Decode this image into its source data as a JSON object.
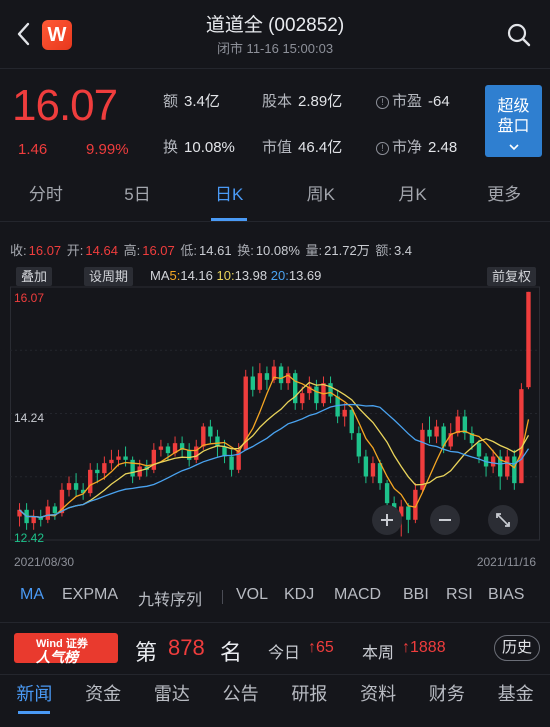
{
  "header": {
    "title": "道道全 (002852)",
    "subtitle": "闭市 11-16 15:00:03",
    "logo_text": "W",
    "icons": {
      "back": "chevron-left-icon",
      "search": "search-icon"
    }
  },
  "quote": {
    "price": "16.07",
    "change": "1.46",
    "change_pct": "9.99%",
    "stats": [
      {
        "label": "额",
        "value": "3.4亿"
      },
      {
        "label": "股本",
        "value": "2.89亿"
      },
      {
        "label": "市盈",
        "value": "-64"
      },
      {
        "label": "换",
        "value": "10.08%"
      },
      {
        "label": "市值",
        "value": "46.4亿"
      },
      {
        "label": "市净",
        "value": "2.48"
      }
    ],
    "level2_button": [
      "超级",
      "盘口"
    ],
    "colors": {
      "up": "#ef3d3d",
      "down": "#1ec28b",
      "accent": "#4a9af5"
    }
  },
  "tabs": [
    {
      "label": "分时",
      "active": false
    },
    {
      "label": "5日",
      "active": false
    },
    {
      "label": "日K",
      "active": true
    },
    {
      "label": "周K",
      "active": false
    },
    {
      "label": "月K",
      "active": false
    },
    {
      "label": "更多",
      "active": false
    }
  ],
  "ohlc": {
    "close_label": "收:",
    "close": "16.07",
    "open_label": "开:",
    "open": "14.64",
    "high_label": "高:",
    "high": "16.07",
    "low_label": "低:",
    "low": "14.61",
    "turnover_label": "换:",
    "turnover": "10.08%",
    "volume_label": "量:",
    "volume": "21.72万",
    "amount_label": "额:",
    "amount": "3.4"
  },
  "chart_controls": {
    "overlay": "叠加",
    "set_period": "设周期",
    "adjust": "前复权",
    "ma5_label": "MA",
    "ma5_num": "5:",
    "ma5": "14.16",
    "ma10_num": "10:",
    "ma10": "13.98",
    "ma20_num": "20:",
    "ma20": "13.69"
  },
  "chart_data": {
    "type": "candlestick",
    "y_labels": [
      "16.07",
      "14.24",
      "12.42"
    ],
    "ylim": [
      12.42,
      16.07
    ],
    "x_start": "2021/08/30",
    "x_end": "2021/11/16",
    "candles": [
      [
        12.7,
        12.8,
        12.55,
        12.9
      ],
      [
        12.8,
        12.6,
        12.5,
        12.9
      ],
      [
        12.6,
        12.7,
        12.5,
        12.8
      ],
      [
        12.7,
        12.65,
        12.55,
        12.8
      ],
      [
        12.65,
        12.85,
        12.6,
        12.95
      ],
      [
        12.85,
        12.75,
        12.65,
        12.9
      ],
      [
        12.75,
        13.1,
        12.7,
        13.2
      ],
      [
        13.1,
        13.2,
        13.0,
        13.3
      ],
      [
        13.2,
        13.1,
        13.0,
        13.35
      ],
      [
        13.1,
        13.05,
        12.95,
        13.2
      ],
      [
        13.05,
        13.4,
        13.0,
        13.5
      ],
      [
        13.4,
        13.35,
        13.2,
        13.5
      ],
      [
        13.35,
        13.5,
        13.25,
        13.6
      ],
      [
        13.5,
        13.55,
        13.4,
        13.7
      ],
      [
        13.55,
        13.6,
        13.45,
        13.7
      ],
      [
        13.6,
        13.55,
        13.45,
        13.75
      ],
      [
        13.55,
        13.3,
        13.2,
        13.6
      ],
      [
        13.3,
        13.45,
        13.25,
        13.55
      ],
      [
        13.45,
        13.4,
        13.3,
        13.55
      ],
      [
        13.4,
        13.7,
        13.35,
        13.8
      ],
      [
        13.7,
        13.75,
        13.6,
        13.85
      ],
      [
        13.75,
        13.65,
        13.55,
        13.8
      ],
      [
        13.65,
        13.8,
        13.6,
        13.9
      ],
      [
        13.8,
        13.7,
        13.6,
        13.9
      ],
      [
        13.7,
        13.55,
        13.45,
        13.8
      ],
      [
        13.55,
        13.75,
        13.5,
        13.85
      ],
      [
        13.75,
        14.05,
        13.7,
        14.1
      ],
      [
        14.05,
        13.9,
        13.8,
        14.15
      ],
      [
        13.9,
        13.75,
        13.6,
        14.0
      ],
      [
        13.75,
        13.6,
        13.5,
        13.85
      ],
      [
        13.6,
        13.4,
        13.3,
        13.7
      ],
      [
        13.4,
        13.7,
        13.35,
        13.8
      ],
      [
        13.7,
        14.8,
        13.7,
        14.9
      ],
      [
        14.8,
        14.6,
        14.5,
        14.95
      ],
      [
        14.6,
        14.85,
        14.55,
        15.0
      ],
      [
        14.85,
        14.75,
        14.6,
        14.95
      ],
      [
        14.75,
        14.95,
        14.7,
        15.05
      ],
      [
        14.95,
        14.7,
        14.6,
        15.0
      ],
      [
        14.7,
        14.85,
        14.6,
        14.95
      ],
      [
        14.85,
        14.4,
        14.3,
        14.9
      ],
      [
        14.4,
        14.55,
        14.3,
        14.65
      ],
      [
        14.55,
        14.65,
        14.45,
        14.8
      ],
      [
        14.65,
        14.4,
        14.3,
        14.75
      ],
      [
        14.4,
        14.7,
        14.35,
        14.8
      ],
      [
        14.7,
        14.5,
        14.4,
        14.8
      ],
      [
        14.5,
        14.2,
        14.1,
        14.6
      ],
      [
        14.2,
        14.3,
        14.05,
        14.4
      ],
      [
        14.3,
        13.95,
        13.85,
        14.35
      ],
      [
        13.95,
        13.6,
        13.5,
        14.05
      ],
      [
        13.6,
        13.3,
        13.2,
        13.7
      ],
      [
        13.3,
        13.5,
        13.2,
        13.6
      ],
      [
        13.5,
        13.2,
        13.1,
        13.55
      ],
      [
        13.2,
        12.9,
        12.8,
        13.25
      ],
      [
        12.9,
        12.7,
        12.55,
        13.0
      ],
      [
        12.7,
        12.85,
        12.4,
        12.95
      ],
      [
        12.85,
        12.65,
        12.45,
        12.9
      ],
      [
        12.65,
        13.1,
        12.6,
        13.2
      ],
      [
        13.1,
        14.0,
        13.05,
        14.1
      ],
      [
        14.0,
        13.9,
        13.8,
        14.2
      ],
      [
        13.9,
        14.05,
        13.8,
        14.15
      ],
      [
        14.05,
        13.75,
        13.65,
        14.1
      ],
      [
        13.75,
        13.95,
        13.7,
        14.1
      ],
      [
        13.95,
        14.2,
        13.9,
        14.3
      ],
      [
        14.2,
        13.95,
        13.85,
        14.3
      ],
      [
        13.95,
        13.8,
        13.7,
        14.05
      ],
      [
        13.8,
        13.6,
        13.5,
        13.85
      ],
      [
        13.6,
        13.45,
        13.3,
        13.65
      ],
      [
        13.45,
        13.6,
        13.35,
        13.7
      ],
      [
        13.6,
        13.3,
        13.1,
        13.7
      ],
      [
        13.3,
        13.6,
        13.25,
        13.7
      ],
      [
        13.6,
        13.2,
        13.1,
        13.7
      ],
      [
        13.2,
        14.61,
        13.2,
        14.7
      ],
      [
        14.64,
        16.07,
        14.61,
        16.07
      ]
    ],
    "candle_format": [
      "open",
      "close",
      "low",
      "high"
    ]
  },
  "chart_zoom": {
    "zoom_in": "zoom-in-icon",
    "zoom_out": "zoom-out-icon",
    "fullscreen": "expand-icon"
  },
  "indicators": [
    {
      "label": "MA",
      "active": true
    },
    {
      "label": "EXPMA",
      "active": false
    },
    {
      "label": "九转序列",
      "active": false
    },
    {
      "label": "VOL",
      "active": false
    },
    {
      "label": "KDJ",
      "active": false
    },
    {
      "label": "MACD",
      "active": false
    },
    {
      "label": "BBI",
      "active": false
    },
    {
      "label": "RSI",
      "active": false
    },
    {
      "label": "BIAS",
      "active": false
    }
  ],
  "rank": {
    "logo_top": "Wind 证券",
    "logo_main": "人气榜",
    "prefix": "第",
    "rank": "878",
    "suffix": "名",
    "today_label": "今日",
    "today_value": "↑65",
    "week_label": "本周",
    "week_value": "↑1888",
    "history": "历史"
  },
  "bottom_nav": [
    {
      "label": "新闻",
      "active": true
    },
    {
      "label": "资金",
      "active": false
    },
    {
      "label": "雷达",
      "active": false
    },
    {
      "label": "公告",
      "active": false
    },
    {
      "label": "研报",
      "active": false
    },
    {
      "label": "资料",
      "active": false
    },
    {
      "label": "财务",
      "active": false
    },
    {
      "label": "基金",
      "active": false
    }
  ]
}
